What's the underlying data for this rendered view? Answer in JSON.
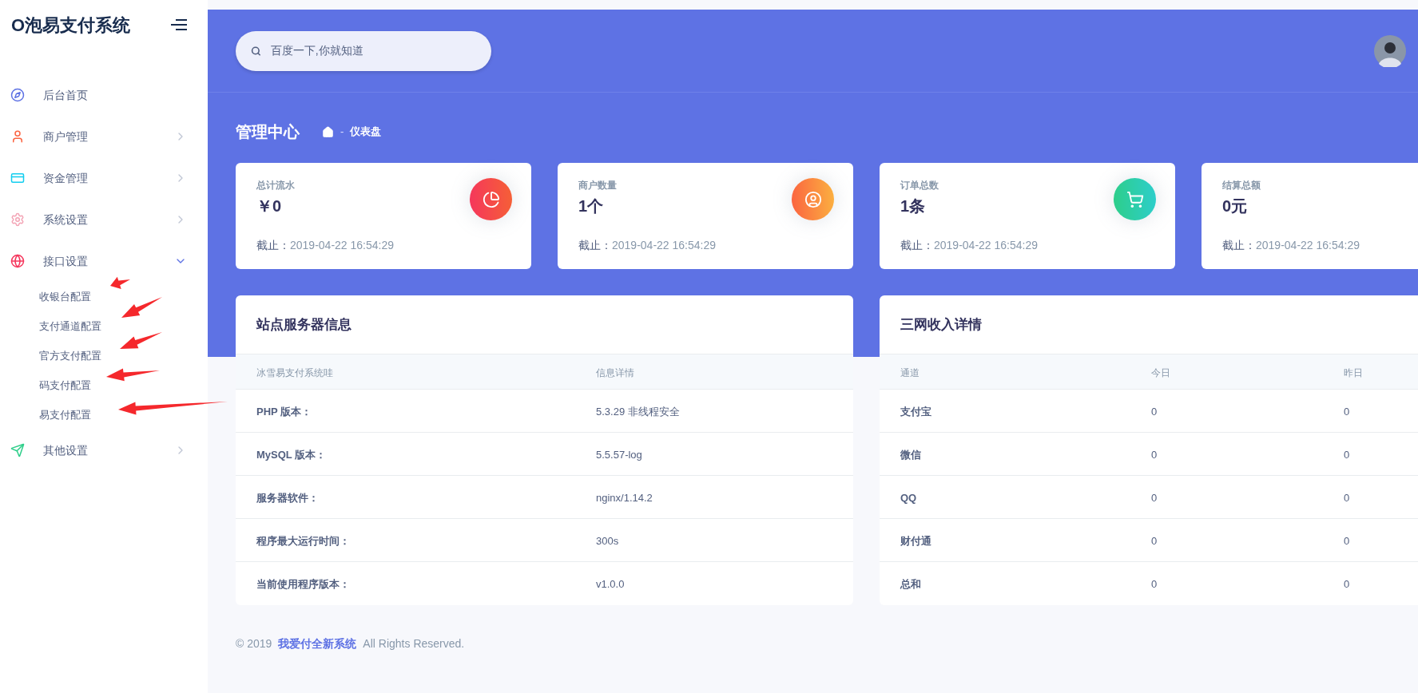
{
  "sidebar": {
    "logo": "O泡易支付系统",
    "items": [
      {
        "label": "后台首页",
        "kind": "link"
      },
      {
        "label": "商户管理",
        "kind": "group",
        "expanded": false
      },
      {
        "label": "资金管理",
        "kind": "group",
        "expanded": false
      },
      {
        "label": "系统设置",
        "kind": "group",
        "expanded": false
      },
      {
        "label": "接口设置",
        "kind": "group",
        "expanded": true,
        "children": [
          {
            "label": "收银台配置"
          },
          {
            "label": "支付通道配置"
          },
          {
            "label": "官方支付配置"
          },
          {
            "label": "码支付配置"
          },
          {
            "label": "易支付配置"
          }
        ]
      },
      {
        "label": "其他设置",
        "kind": "group",
        "expanded": false
      }
    ]
  },
  "header": {
    "search": {
      "placeholder": "百度一下,你就知道"
    }
  },
  "page": {
    "title": "管理中心",
    "breadcrumb": {
      "separator": "-",
      "current": "仪表盘"
    }
  },
  "stats": [
    {
      "label": "总计流水",
      "value": "￥0",
      "note_label": "截止：",
      "note_value": "2019-04-22 16:54:29"
    },
    {
      "label": "商户数量",
      "value": "1个",
      "note_label": "截止：",
      "note_value": "2019-04-22 16:54:29"
    },
    {
      "label": "订单总数",
      "value": "1条",
      "note_label": "截止：",
      "note_value": "2019-04-22 16:54:29"
    },
    {
      "label": "结算总额",
      "value": "0元",
      "note_label": "截止：",
      "note_value": "2019-04-22 16:54:29"
    }
  ],
  "server_panel": {
    "title": "站点服务器信息",
    "columns": [
      "冰雪易支付系统哇",
      "信息详情"
    ],
    "rows": [
      [
        "PHP 版本：",
        "5.3.29 非线程安全"
      ],
      [
        "MySQL 版本：",
        "5.5.57-log"
      ],
      [
        "服务器软件：",
        "nginx/1.14.2"
      ],
      [
        "程序最大运行时间：",
        "300s"
      ],
      [
        "当前使用程序版本：",
        "v1.0.0"
      ]
    ]
  },
  "income_panel": {
    "title": "三网收入详情",
    "columns": [
      "通道",
      "今日",
      "昨日"
    ],
    "rows": [
      [
        "支付宝",
        "0",
        "0"
      ],
      [
        "微信",
        "0",
        "0"
      ],
      [
        "QQ",
        "0",
        "0"
      ],
      [
        "财付通",
        "0",
        "0"
      ],
      [
        "总和",
        "0",
        "0"
      ]
    ]
  },
  "footer": {
    "copyright": "© 2019",
    "link": "我爱付全新系统",
    "rights": "All Rights Reserved."
  }
}
